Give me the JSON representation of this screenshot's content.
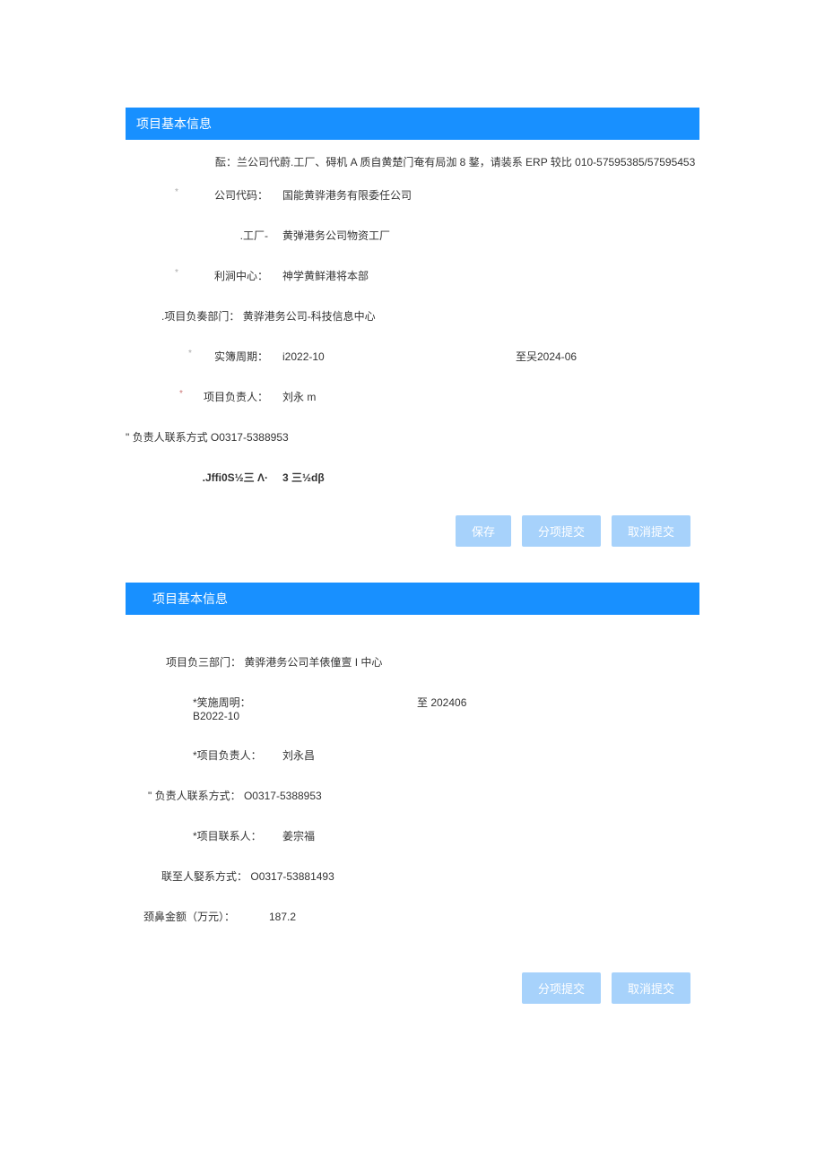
{
  "section1": {
    "header": "项目基本信息",
    "note": "酝：兰公司代蔚.工厂、碍机 A 质自黄楚门奄有局泇 8 鍪，请装系 ERP 较比 010-57595385/57595453",
    "company_code_label": "公司代码：",
    "company_code_value": "国能黄骅港务有限委任公司",
    "factory_label": ".工厂-",
    "factory_value": "黄弹港务公司物资工厂",
    "profit_center_label": "利涧中心：",
    "profit_center_value": "神学黄鲜港将本部",
    "dept_label": ".项目负奏部门：",
    "dept_value": "黄骅港务公司-科技信息中心",
    "period_label": "实簿周期：",
    "period_start": "i2022-10",
    "period_mid": "至㕦2024-06",
    "leader_label": "项目负责人：",
    "leader_value": "刘永 m",
    "leader_contact_label": "\" 负责人联系方式 O0317-5388953",
    "misc_label": ".Jffi0S½三 Λ·",
    "misc_value": "3 三½dβ"
  },
  "buttons1": {
    "save": "保存",
    "submit": "分项提交",
    "cancel": "取消提交"
  },
  "section2": {
    "header": "项目基本信息",
    "dept_label": "项目负三部门：",
    "dept_value": "黄骅港务公司羊俵僮亶 I 中心",
    "period_label": "*笑施周明：",
    "period_start": "B2022-10",
    "period_mid": "至 202406",
    "leader_label": "*项目负责人：",
    "leader_value": "刘永昌",
    "leader_contact_label": "\" 负责人联系方式：",
    "leader_contact_value": "O0317-5388953",
    "contact_label": "*项目联系人：",
    "contact_value": "姜宗福",
    "contact_phone_label": "联至人婜系方式：",
    "contact_phone_value": "O0317-53881493",
    "amount_label": "颈鼻金额（万元）：",
    "amount_value": "187.2"
  },
  "buttons2": {
    "submit": "分项提交",
    "cancel": "取消提交"
  }
}
